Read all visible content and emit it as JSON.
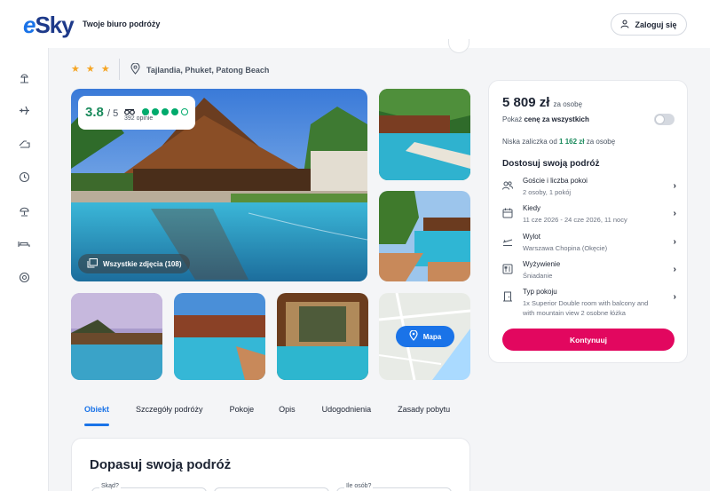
{
  "header": {
    "logo_text": "eSky",
    "tagline": "Twoje biuro podróży",
    "login_label": "Zaloguj się"
  },
  "sidebar": {
    "icons": [
      "beach-icon",
      "plane-icon",
      "plane-hotel-icon",
      "clock-icon",
      "umbrella-icon",
      "bed-icon",
      "headset-icon"
    ]
  },
  "hotel": {
    "stars": "★ ★ ★",
    "star_count": 3,
    "location": "Tajlandia, Phuket, Patong Beach"
  },
  "rating": {
    "score": "3.8",
    "max": "/ 5",
    "count_label": "392 opinie",
    "dots_filled": 4,
    "dots_total": 5
  },
  "gallery": {
    "all_photos_label": "Wszystkie zdjęcia (108)",
    "map_label": "Mapa"
  },
  "tabs": [
    {
      "label": "Obiekt",
      "active": true
    },
    {
      "label": "Szczegóły podróży",
      "active": false
    },
    {
      "label": "Pokoje",
      "active": false
    },
    {
      "label": "Opis",
      "active": false
    },
    {
      "label": "Udogodnienia",
      "active": false
    },
    {
      "label": "Zasady pobytu",
      "active": false
    }
  ],
  "booking": {
    "title": "Dopasuj swoją podróż",
    "field_from_label": "Skąd?",
    "field_people_label": "Ile osób?"
  },
  "panel": {
    "price": "5 809 zł",
    "price_suffix": "za osobę",
    "toggle_prefix": "Pokaż ",
    "toggle_bold": "cenę za wszystkich",
    "deposit_prefix": "Niska zaliczka od ",
    "deposit_amount": "1 162 zł",
    "deposit_suffix": " za osobę",
    "customize_title": "Dostosuj swoją podróż",
    "options": [
      {
        "icon": "guests-icon",
        "title": "Goście i liczba pokoi",
        "value": "2 osoby, 1 pokój"
      },
      {
        "icon": "calendar-icon",
        "title": "Kiedy",
        "value": "11 cze 2026 - 24 cze 2026, 11 nocy"
      },
      {
        "icon": "departure-icon",
        "title": "Wylot",
        "value": "Warszawa Chopina (Okęcie)"
      },
      {
        "icon": "meal-icon",
        "title": "Wyżywienie",
        "value": "Śniadanie"
      },
      {
        "icon": "door-icon",
        "title": "Typ pokoju",
        "value": "1x Superior Double room with balcony and with mountain view 2 osobne łóżka"
      }
    ],
    "continue_label": "Kontynuuj"
  },
  "colors": {
    "brand_blue": "#1a73e8",
    "rating_green": "#00aa6c",
    "cta_pink": "#e2075f"
  }
}
